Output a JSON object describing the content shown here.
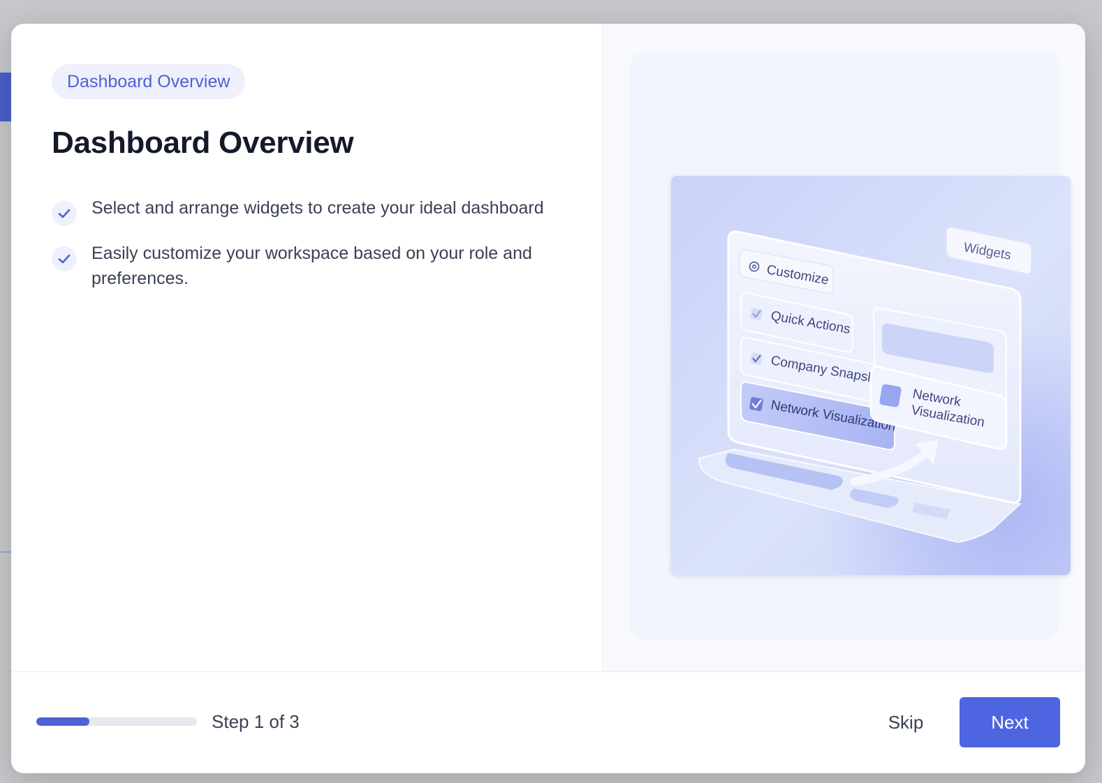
{
  "modal": {
    "pill_label": "Dashboard Overview",
    "title": "Dashboard Overview",
    "features": [
      "Select and arrange widgets to create your ideal dashboard",
      "Easily customize your workspace based on your role and preferences."
    ]
  },
  "illustration": {
    "customize_label": "Customize",
    "widgets_label": "Widgets",
    "items": [
      "Quick Actions",
      "Company Snapshot",
      "Network Visualization"
    ],
    "drag_card_line1": "Network",
    "drag_card_line2": "Visualization"
  },
  "footer": {
    "step_label": "Step 1 of 3",
    "progress": 0.33,
    "skip_label": "Skip",
    "next_label": "Next"
  },
  "colors": {
    "accent": "#4d62d6",
    "button": "#4d65e0",
    "pill_bg": "#eef0fb",
    "title": "#141a2b",
    "body_text": "#3a4155",
    "backdrop": "#c6c7ca"
  },
  "icons": {
    "feature_bullet": "check-icon",
    "customize": "gear-icon"
  }
}
